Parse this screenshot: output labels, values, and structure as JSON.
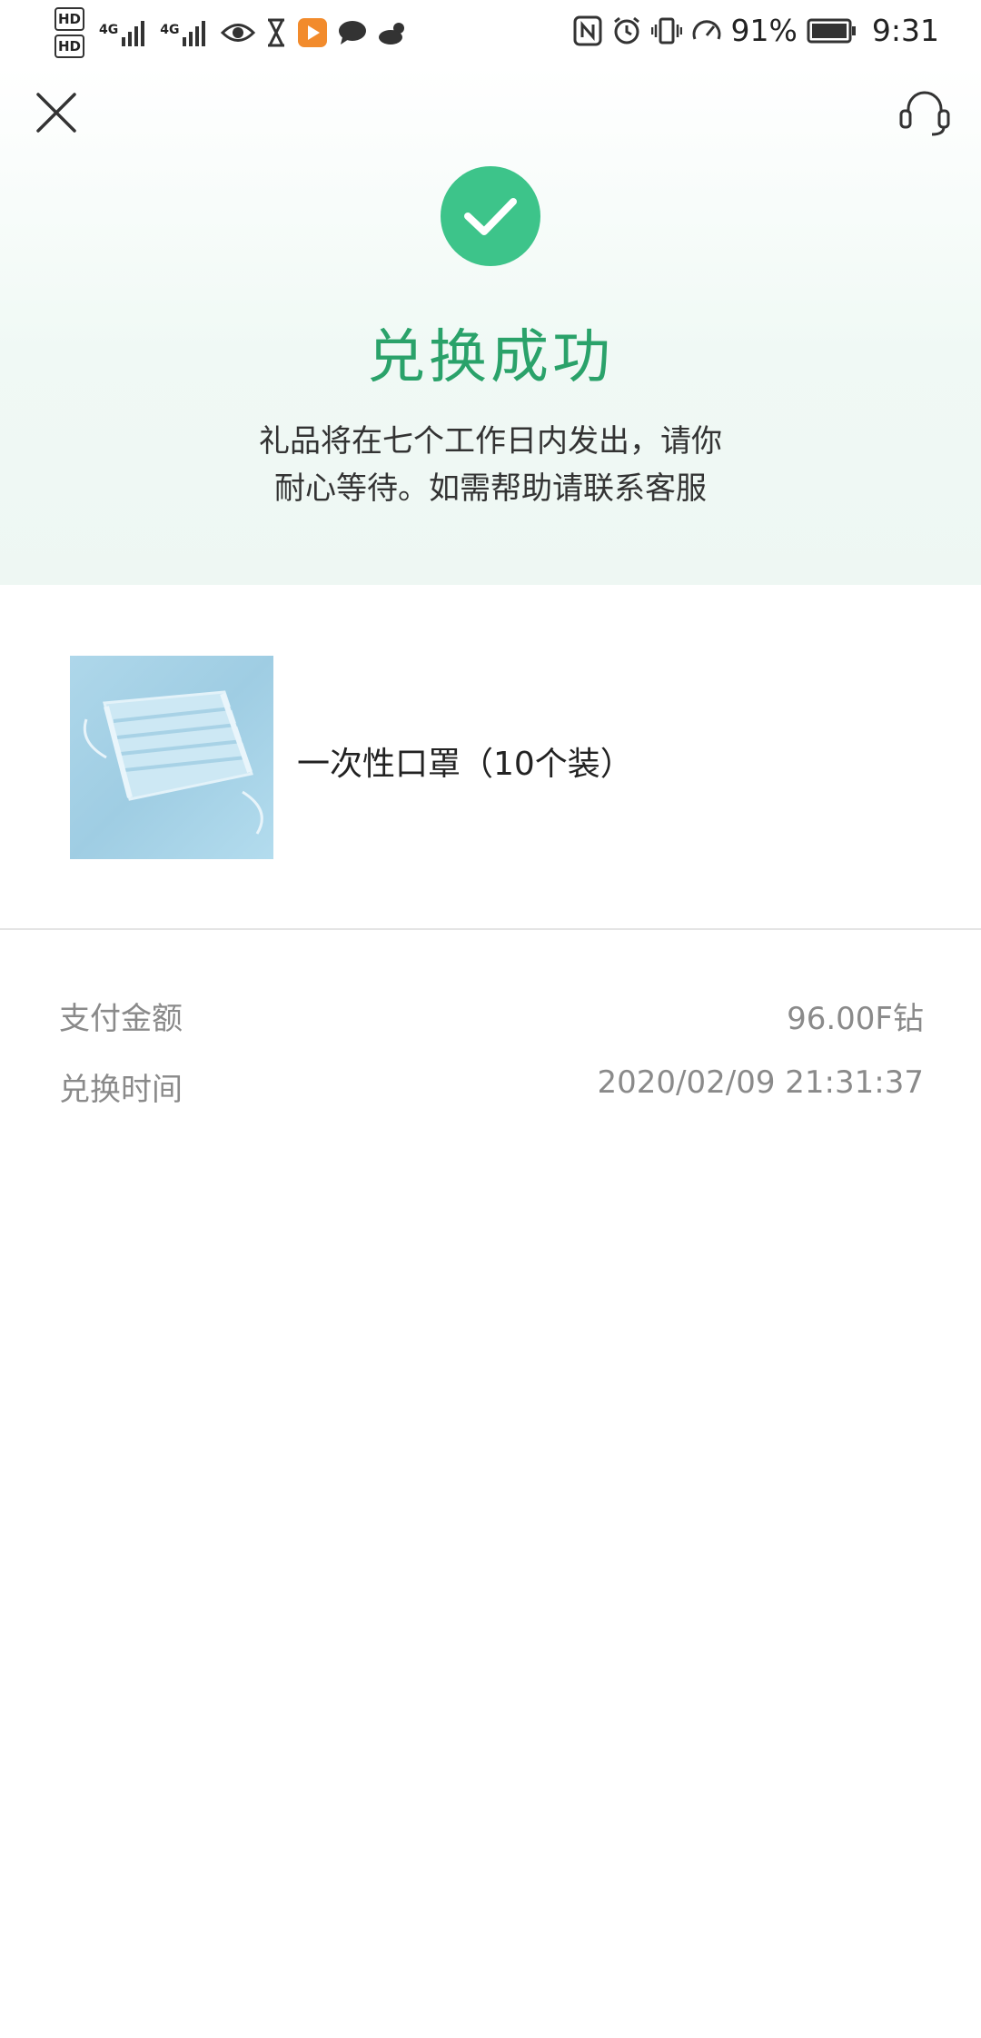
{
  "status_bar": {
    "left_icons": [
      "hd1-icon",
      "hd2-icon",
      "4g-signal-icon",
      "4g-signal-icon-2",
      "eye-icon",
      "hourglass-icon",
      "video-app-icon",
      "chat-bubble-icon",
      "weather-icon"
    ],
    "hd1": "HD",
    "hd2": "HD",
    "net1": "4G",
    "net2": "4G",
    "right_icons": [
      "nfc-icon",
      "alarm-icon",
      "vibrate-icon",
      "speed-icon",
      "battery-icon"
    ],
    "battery_percent": "91%",
    "time": "9:31"
  },
  "header": {
    "close_icon": "close-icon",
    "support_icon": "headset-icon"
  },
  "hero": {
    "title": "兑换成功",
    "message": "礼品将在七个工作日内发出，请你耐心等待。如需帮助请联系客服",
    "message_line1": "礼品将在七个工作日内发出，请你",
    "message_line2": "耐心等待。如需帮助请联系客服",
    "accent": "#3dc48a",
    "title_color": "#2aa26a"
  },
  "product": {
    "name": "一次性口罩（10个装）",
    "image_icon": "face-mask-image"
  },
  "details": {
    "payment_label": "支付金额",
    "payment_value": "96.00F钻",
    "time_label": "兑换时间",
    "time_value": "2020/02/09 21:31:37"
  }
}
